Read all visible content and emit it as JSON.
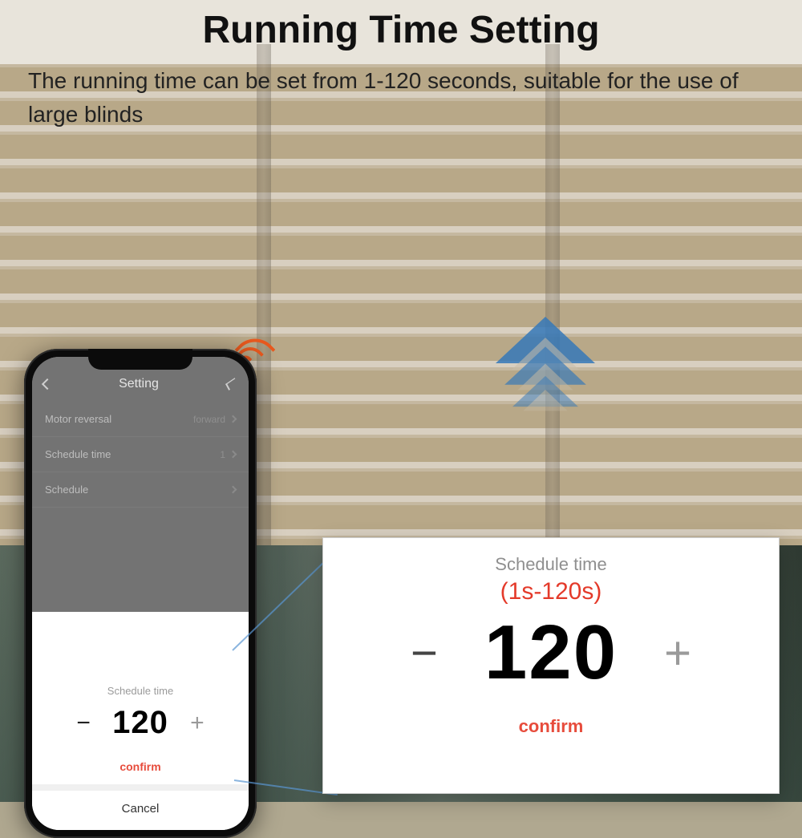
{
  "header": {
    "title": "Running Time Setting",
    "subtitle": "The running time can be set from 1-120 seconds, suitable for the use of large blinds"
  },
  "phone": {
    "screen_title": "Setting",
    "rows": [
      {
        "label": "Motor reversal",
        "value": "forward"
      },
      {
        "label": "Schedule time",
        "value": "1"
      },
      {
        "label": "Schedule",
        "value": ""
      }
    ],
    "sheet": {
      "title": "Schedule time",
      "value": "120",
      "minus": "−",
      "plus": "+",
      "confirm": "confirm",
      "cancel": "Cancel"
    }
  },
  "zoom": {
    "title": "Schedule time",
    "range": "(1s-120s)",
    "value": "120",
    "minus": "−",
    "plus": "+",
    "confirm": "confirm"
  }
}
